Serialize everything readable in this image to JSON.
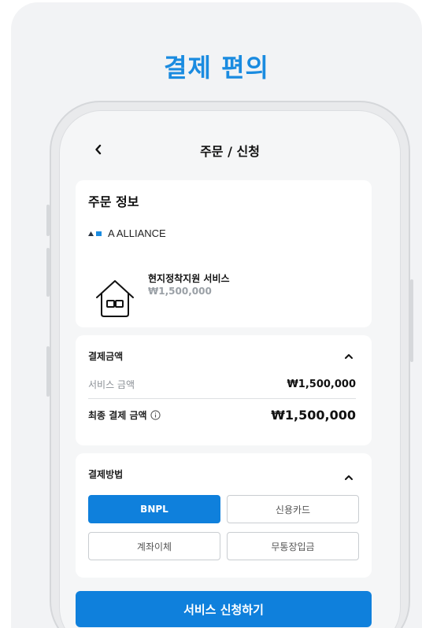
{
  "headline": "결제 편의",
  "nav": {
    "title": "주문 / 신청"
  },
  "order": {
    "title": "주문 정보",
    "brand": "A ALLIANCE",
    "service_name": "현지정착지원 서비스",
    "service_price": "₩1,500,000"
  },
  "payment_amount": {
    "title": "결제금액",
    "service_label": "서비스 금액",
    "service_value": "₩1,500,000",
    "final_label": "최종 결제 금액",
    "final_value": "₩1,500,000"
  },
  "payment_method": {
    "title": "결제방법",
    "options": [
      "BNPL",
      "신용카드",
      "계좌이체",
      "무통장입금"
    ],
    "selected": "BNPL"
  },
  "cta": {
    "label": "서비스 신청하기"
  },
  "colors": {
    "accent": "#0f80dc",
    "headline": "#1a8be0"
  }
}
